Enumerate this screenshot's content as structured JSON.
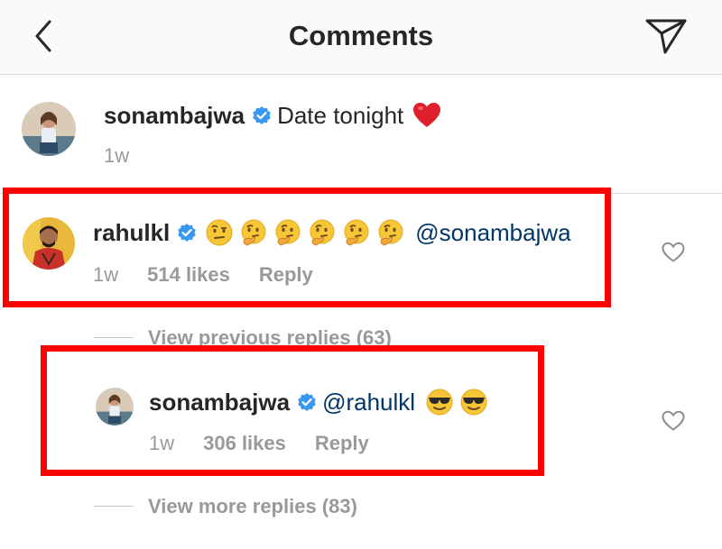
{
  "header": {
    "title": "Comments",
    "back_icon": "chevron-left-icon",
    "send_icon": "paper-plane-icon"
  },
  "caption": {
    "username": "sonambajwa",
    "text": "Date tonight",
    "emoji": "❤️",
    "time": "1w"
  },
  "comment": {
    "username": "rahulkl",
    "emojis": [
      "🤨",
      "🤔",
      "🤔",
      "🤔",
      "🤔",
      "🤔"
    ],
    "mention": "@sonambajwa",
    "time": "1w",
    "likes": "514 likes",
    "reply": "Reply",
    "view_previous": "View previous replies (63)"
  },
  "reply": {
    "username": "sonambajwa",
    "mention": "@rahulkl",
    "emojis": [
      "😎",
      "😎"
    ],
    "time": "1w",
    "likes": "306 likes",
    "reply": "Reply",
    "view_more": "View more replies (83)"
  },
  "colors": {
    "verified": "#3897f0",
    "mention": "#003569",
    "meta": "#999999",
    "highlight": "#ff0000",
    "heart_caption": "#ed4956"
  }
}
